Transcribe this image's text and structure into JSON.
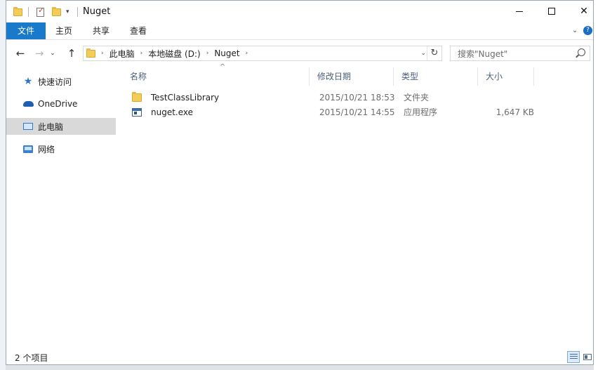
{
  "window": {
    "title": "Nuget"
  },
  "ribbon": {
    "tabs": [
      "文件",
      "主页",
      "共享",
      "查看"
    ]
  },
  "address": {
    "crumbs": [
      "此电脑",
      "本地磁盘 (D:)",
      "Nuget"
    ]
  },
  "search": {
    "placeholder": "搜索\"Nuget\""
  },
  "nav": {
    "items": [
      "快速访问",
      "OneDrive",
      "此电脑",
      "网络"
    ],
    "selected": "此电脑"
  },
  "columns": [
    "名称",
    "修改日期",
    "类型",
    "大小"
  ],
  "files": [
    {
      "name": "TestClassLibrary",
      "date": "2015/10/21 18:53",
      "type": "文件夹",
      "size": "",
      "icon": "folder-icon"
    },
    {
      "name": "nuget.exe",
      "date": "2015/10/21 14:55",
      "type": "应用程序",
      "size": "1,647 KB",
      "icon": "exe-icon"
    }
  ],
  "status": {
    "text": "2 个项目"
  },
  "colors": {
    "accent": "#1979ca",
    "selected": "#d9d9d9",
    "header_text": "#4c607a"
  }
}
